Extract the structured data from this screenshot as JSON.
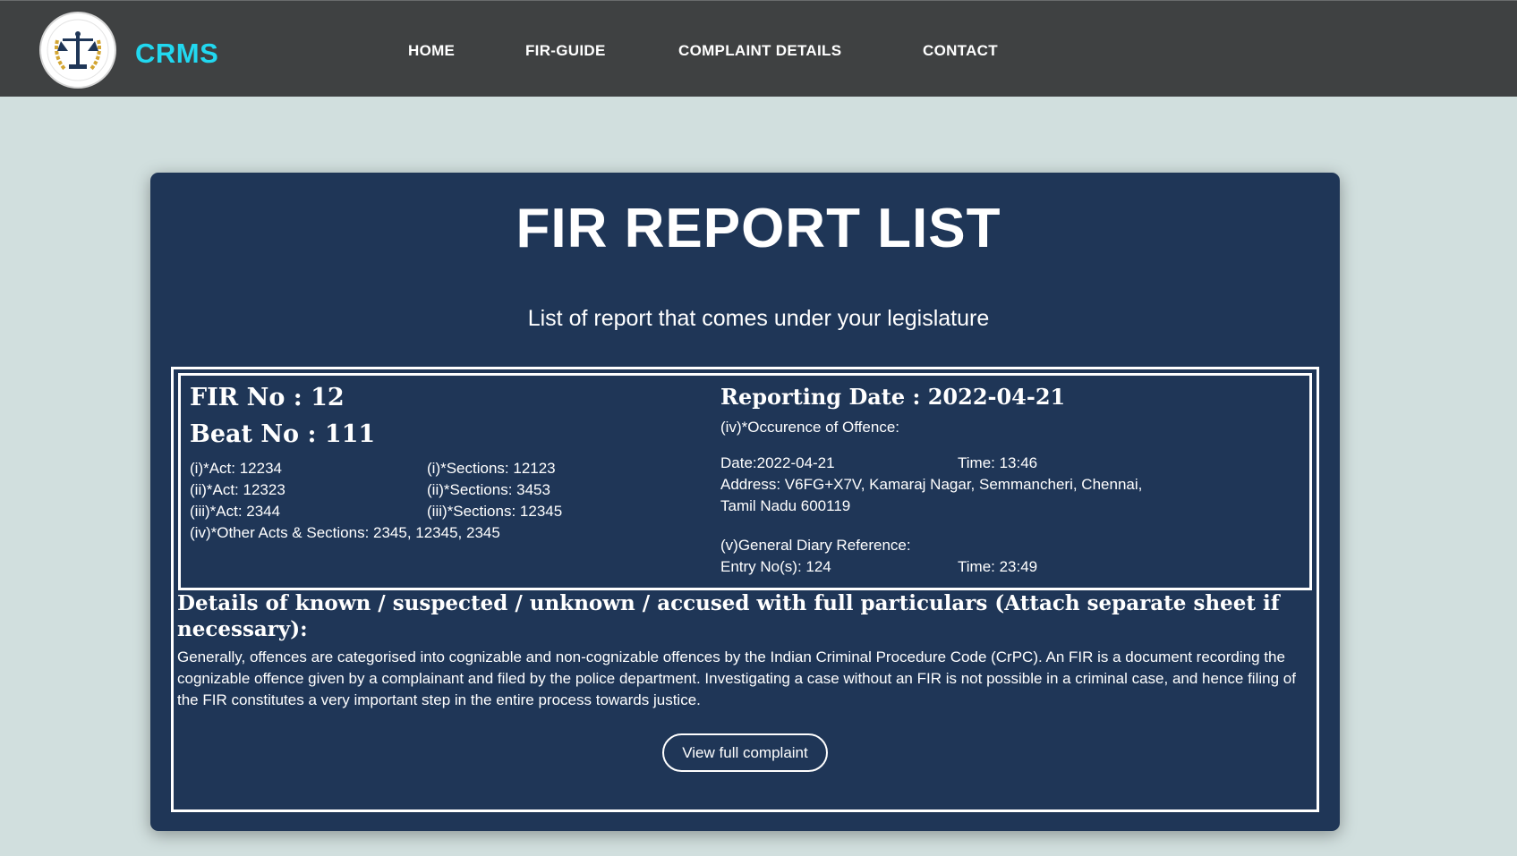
{
  "brand": {
    "name": "CRMS",
    "logo_icon": "scales-of-justice-emblem-icon"
  },
  "nav": {
    "items": [
      "HOME",
      "FIR-GUIDE",
      "COMPLAINT DETAILS",
      "CONTACT"
    ]
  },
  "page": {
    "title": "FIR REPORT LIST",
    "subtitle": "List of report that comes under your legislature"
  },
  "report": {
    "fir_no": "FIR No : 12",
    "beat_no": "Beat No : 111",
    "acts": [
      "(i)*Act: 12234",
      "(ii)*Act: 12323",
      "(iii)*Act: 2344"
    ],
    "sections": [
      "(i)*Sections: 12123",
      "(ii)*Sections: 3453",
      "(iii)*Sections: 12345"
    ],
    "other_acts": "(iv)*Other Acts & Sections: 2345, 12345, 2345",
    "reporting_date": "Reporting Date : 2022-04-21",
    "occurrence_label": "(iv)*Occurence of Offence:",
    "occurrence_date": "Date:2022-04-21",
    "occurrence_time": "Time: 13:46",
    "address_line1": "Address: V6FG+X7V, Kamaraj Nagar, Semmancheri, Chennai,",
    "address_line2": "Tamil Nadu 600119",
    "gd_label": "(v)General Diary Reference:",
    "gd_entry": "Entry No(s): 124",
    "gd_time": "Time: 23:49",
    "details_heading": "Details of known / suspected / unknown / accused with full particulars (Attach separate sheet if necessary):",
    "details_body": "Generally, offences are categorised into cognizable and non-cognizable offences by the Indian Criminal Procedure Code (CrPC). An FIR is a document recording the cognizable offence given by a complainant and filed by the police department. Investigating a case without an FIR is not possible in a criminal case, and hence filing of the FIR constitutes a very important step in the entire process towards justice.",
    "view_button": "View full complaint"
  },
  "colors": {
    "background": "#d1dfde",
    "navbar": "#3f4142",
    "brand": "#21d8f0",
    "card": "#1f3657",
    "text": "#ffffff"
  }
}
